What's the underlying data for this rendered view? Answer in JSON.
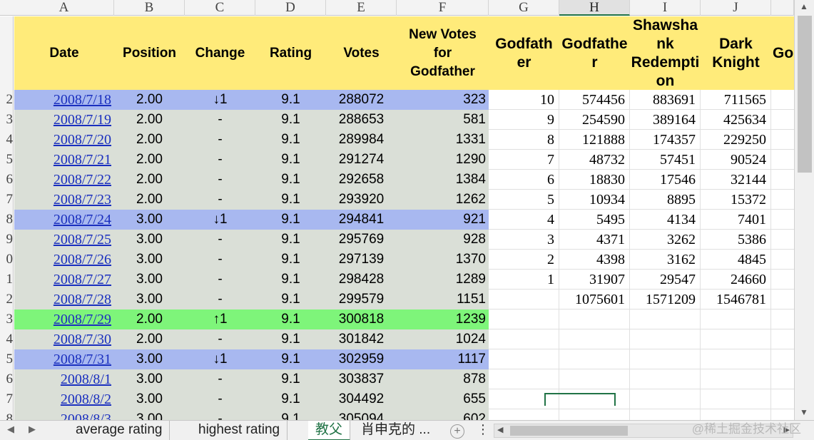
{
  "columns": [
    "A",
    "B",
    "C",
    "D",
    "E",
    "F",
    "G",
    "H",
    "I",
    "J"
  ],
  "rows": [
    "2",
    "3",
    "4",
    "5",
    "6",
    "7",
    "8",
    "9",
    "0",
    "1",
    "2",
    "3",
    "4",
    "5",
    "6",
    "7",
    "8"
  ],
  "header": {
    "date": "Date",
    "position": "Position",
    "change": "Change",
    "rating": "Rating",
    "votes": "Votes",
    "new_votes_lines": [
      "New Votes",
      "for",
      "Godfather"
    ],
    "g_lines": [
      "Godfath",
      "er"
    ],
    "h_lines": [
      "Godfathe",
      "r"
    ],
    "i_lines": [
      "Shawsha",
      "nk",
      "Redempti",
      "on"
    ],
    "j_lines": [
      "Dark",
      "Knight"
    ],
    "k": "Go"
  },
  "data_rows": [
    {
      "date": "2008/7/18",
      "position": "2.00",
      "change": "↓1",
      "rating": "9.1",
      "votes": "288072",
      "new_votes": "323",
      "highlight": "blue"
    },
    {
      "date": "2008/7/19",
      "position": "2.00",
      "change": "-",
      "rating": "9.1",
      "votes": "288653",
      "new_votes": "581",
      "highlight": "grey"
    },
    {
      "date": "2008/7/20",
      "position": "2.00",
      "change": "-",
      "rating": "9.1",
      "votes": "289984",
      "new_votes": "1331",
      "highlight": "grey"
    },
    {
      "date": "2008/7/21",
      "position": "2.00",
      "change": "-",
      "rating": "9.1",
      "votes": "291274",
      "new_votes": "1290",
      "highlight": "grey"
    },
    {
      "date": "2008/7/22",
      "position": "2.00",
      "change": "-",
      "rating": "9.1",
      "votes": "292658",
      "new_votes": "1384",
      "highlight": "grey"
    },
    {
      "date": "2008/7/23",
      "position": "2.00",
      "change": "-",
      "rating": "9.1",
      "votes": "293920",
      "new_votes": "1262",
      "highlight": "grey"
    },
    {
      "date": "2008/7/24",
      "position": "3.00",
      "change": "↓1",
      "rating": "9.1",
      "votes": "294841",
      "new_votes": "921",
      "highlight": "blue"
    },
    {
      "date": "2008/7/25",
      "position": "3.00",
      "change": "-",
      "rating": "9.1",
      "votes": "295769",
      "new_votes": "928",
      "highlight": "grey"
    },
    {
      "date": "2008/7/26",
      "position": "3.00",
      "change": "-",
      "rating": "9.1",
      "votes": "297139",
      "new_votes": "1370",
      "highlight": "grey"
    },
    {
      "date": "2008/7/27",
      "position": "3.00",
      "change": "-",
      "rating": "9.1",
      "votes": "298428",
      "new_votes": "1289",
      "highlight": "grey"
    },
    {
      "date": "2008/7/28",
      "position": "3.00",
      "change": "-",
      "rating": "9.1",
      "votes": "299579",
      "new_votes": "1151",
      "highlight": "grey"
    },
    {
      "date": "2008/7/29",
      "position": "2.00",
      "change": "↑1",
      "rating": "9.1",
      "votes": "300818",
      "new_votes": "1239",
      "highlight": "green"
    },
    {
      "date": "2008/7/30",
      "position": "2.00",
      "change": "-",
      "rating": "9.1",
      "votes": "301842",
      "new_votes": "1024",
      "highlight": "grey"
    },
    {
      "date": "2008/7/31",
      "position": "3.00",
      "change": "↓1",
      "rating": "9.1",
      "votes": "302959",
      "new_votes": "1117",
      "highlight": "blue"
    },
    {
      "date": "2008/8/1",
      "position": "3.00",
      "change": "-",
      "rating": "9.1",
      "votes": "303837",
      "new_votes": "878",
      "highlight": "grey"
    },
    {
      "date": "2008/8/2",
      "position": "3.00",
      "change": "-",
      "rating": "9.1",
      "votes": "304492",
      "new_votes": "655",
      "highlight": "grey"
    },
    {
      "date": "2008/8/3",
      "position": "3.00",
      "change": "-",
      "rating": "9.1",
      "votes": "305094",
      "new_votes": "602",
      "highlight": "grey"
    }
  ],
  "distribution_rows": [
    {
      "g": "10",
      "h": "574456",
      "i": "883691",
      "j": "711565"
    },
    {
      "g": "9",
      "h": "254590",
      "i": "389164",
      "j": "425634"
    },
    {
      "g": "8",
      "h": "121888",
      "i": "174357",
      "j": "229250"
    },
    {
      "g": "7",
      "h": "48732",
      "i": "57451",
      "j": "90524"
    },
    {
      "g": "6",
      "h": "18830",
      "i": "17546",
      "j": "32144"
    },
    {
      "g": "5",
      "h": "10934",
      "i": "8895",
      "j": "15372"
    },
    {
      "g": "4",
      "h": "5495",
      "i": "4134",
      "j": "7401"
    },
    {
      "g": "3",
      "h": "4371",
      "i": "3262",
      "j": "5386"
    },
    {
      "g": "2",
      "h": "4398",
      "i": "3162",
      "j": "4845"
    },
    {
      "g": "1",
      "h": "31907",
      "i": "29547",
      "j": "24660"
    },
    {
      "g": "",
      "h": "1075601",
      "i": "1571209",
      "j": "1546781"
    }
  ],
  "tabs": [
    "average rating",
    "highest rating",
    "教父",
    "肖申克的 ..."
  ],
  "active_tab": "教父",
  "watermark": "@稀土掘金技术社区",
  "colors": {
    "header_fill": "#ffeb7a",
    "grey_fill": "#dadfd7",
    "blue_fill": "#a8b8f0",
    "green_fill": "#7ef57a",
    "link": "#1a2fbf",
    "accent": "#217346"
  },
  "icons": {
    "tab_prev": "triangle-left-icon",
    "tab_next": "triangle-right-icon",
    "add_sheet": "plus-circle-icon",
    "more": "vertical-ellipsis-icon"
  }
}
